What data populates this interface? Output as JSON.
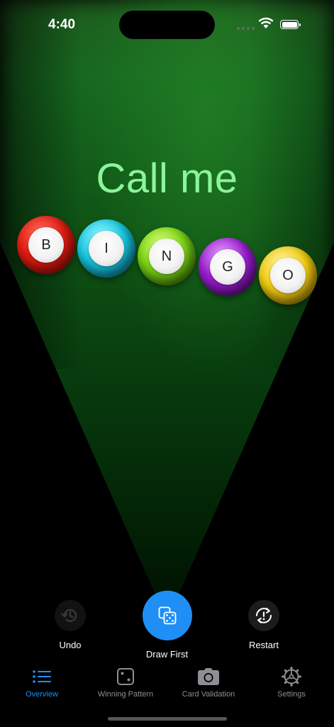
{
  "status_bar": {
    "time": "4:40"
  },
  "hero": {
    "title": "Call me"
  },
  "balls": [
    {
      "letter": "B",
      "color": "#e01c12"
    },
    {
      "letter": "I",
      "color": "#19c6e0"
    },
    {
      "letter": "N",
      "color": "#7ad214"
    },
    {
      "letter": "G",
      "color": "#9a1ecf"
    },
    {
      "letter": "O",
      "color": "#f2cc12"
    }
  ],
  "actions": {
    "undo": {
      "label": "Undo",
      "icon": "history-icon"
    },
    "draw": {
      "label": "Draw First",
      "icon": "dice-icon",
      "color": "#1f8ff5"
    },
    "restart": {
      "label": "Restart",
      "icon": "restart-alert-icon"
    }
  },
  "tabs": [
    {
      "label": "Overview",
      "icon": "list-icon",
      "active": true
    },
    {
      "label": "Winning Pattern",
      "icon": "dice-square-icon",
      "active": false
    },
    {
      "label": "Card Validation",
      "icon": "camera-icon",
      "active": false
    },
    {
      "label": "Settings",
      "icon": "gear-icon",
      "active": false
    }
  ],
  "colors": {
    "accent": "#1f8ff5",
    "title": "#8cf59a",
    "inactive": "#8e8e93"
  }
}
